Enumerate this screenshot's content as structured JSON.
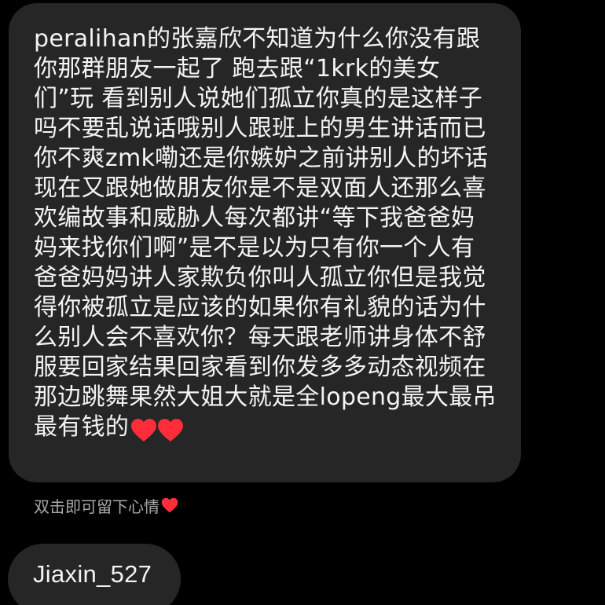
{
  "message": {
    "text": "peralihan的张嘉欣不知道为什么你没有跟你那群朋友一起了 跑去跟“1krk的美女们”玩 看到别人说她们孤立你真的是这样子吗不要乱说话哦别人跟班上的男生讲话而已你不爽zmk嘞还是你嫉妒之前讲别人的坏话现在又跟她做朋友你是不是双面人还那么喜欢编故事和威胁人每次都讲“等下我爸爸妈妈来找你们啊”是不是以为只有你一个人有爸爸妈妈讲人家欺负你叫人孤立你但是我觉得你被孤立是应该的如果你有礼貌的话为什么别人会不喜欢你？每天跟老师讲身体不舒服要回家结果回家看到你发多多动态视频在那边跳舞果然大姐大就是全lopeng最大最吊最有钱的",
    "trailing_icons": [
      "heart-icon",
      "heart-icon"
    ]
  },
  "reaction_hint": {
    "text": "双击即可留下心情",
    "icon": "heart-icon"
  },
  "username": {
    "text": "Jiaxin_527"
  },
  "colors": {
    "background": "#000000",
    "bubble": "#262626",
    "heart": "#ff2d3a",
    "hint_text": "#a8a8a8"
  }
}
